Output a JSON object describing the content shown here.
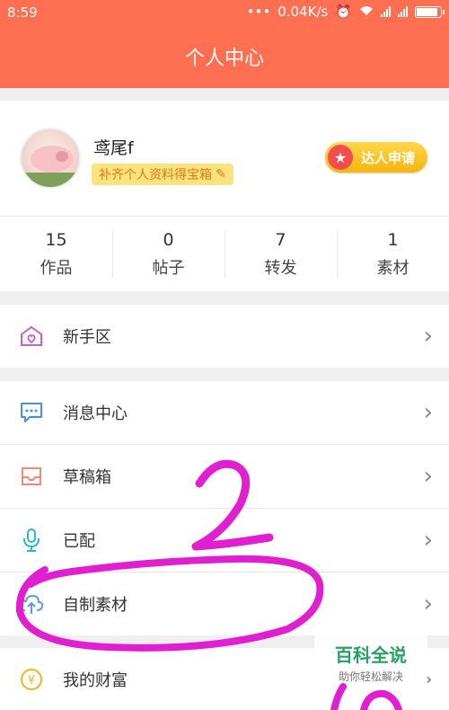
{
  "status_bar": {
    "time": "8:59",
    "network_speed": "0.04K/s"
  },
  "header": {
    "title": "个人中心"
  },
  "profile": {
    "username": "鸢尾f",
    "tag": "补齐个人资料得宝箱",
    "apply_button": "达人申请"
  },
  "stats": [
    {
      "value": "15",
      "label": "作品"
    },
    {
      "value": "0",
      "label": "帖子"
    },
    {
      "value": "7",
      "label": "转发"
    },
    {
      "value": "1",
      "label": "素材"
    }
  ],
  "menu": {
    "newbie": {
      "label": "新手区",
      "icon": "newbie-house-icon"
    },
    "messages": {
      "label": "消息中心",
      "icon": "message-bubble-icon"
    },
    "drafts": {
      "label": "草稿箱",
      "icon": "inbox-tray-icon"
    },
    "dubbed": {
      "label": "已配",
      "icon": "microphone-icon"
    },
    "materials": {
      "label": "自制素材",
      "icon": "cloud-upload-icon"
    },
    "wealth": {
      "label": "我的财富",
      "icon": "yen-coin-icon"
    }
  },
  "watermark": {
    "title": "百科全说",
    "subtitle": "助你轻松解决"
  },
  "colors": {
    "header": "#ff6f52",
    "tag_bg": "#fde37d",
    "apply_button": "#f6b40f",
    "annotation": "#e020d0"
  }
}
